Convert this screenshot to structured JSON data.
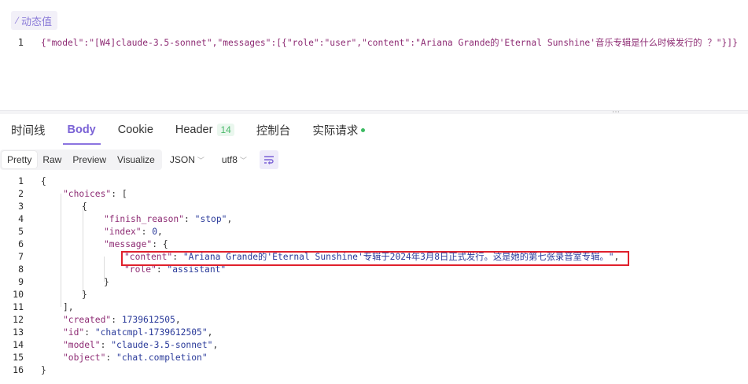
{
  "top": {
    "dynamic_button_label": "动态值",
    "request_line_number": "1",
    "request_body": "{\"model\":\"[W4]claude-3.5-sonnet\",\"messages\":[{\"role\":\"user\",\"content\":\"Ariana Grande的'Eternal Sunshine'音乐专辑是什么时候发行的 ？\"}]}"
  },
  "tabs": [
    {
      "label": "时间线"
    },
    {
      "label": "Body",
      "active": true
    },
    {
      "label": "Cookie"
    },
    {
      "label": "Header",
      "badge": "14"
    },
    {
      "label": "控制台"
    },
    {
      "label": "实际请求",
      "status_dot": true
    }
  ],
  "toolbar": {
    "view_modes": [
      "Pretty",
      "Raw",
      "Preview",
      "Visualize"
    ],
    "active_view": "Pretty",
    "format": "JSON",
    "encoding": "utf8"
  },
  "response_lines": [
    {
      "n": "1",
      "text": "{"
    },
    {
      "n": "2",
      "key": "\"choices\"",
      "rest": ": ["
    },
    {
      "n": "3",
      "text": "{"
    },
    {
      "n": "4",
      "key": "\"finish_reason\"",
      "rest": ": ",
      "val": "\"stop\"",
      "tail": ","
    },
    {
      "n": "5",
      "key": "\"index\"",
      "rest": ": ",
      "val": "0",
      "tail": ","
    },
    {
      "n": "6",
      "key": "\"message\"",
      "rest": ": {"
    },
    {
      "n": "7",
      "key": "\"content\"",
      "rest": ": ",
      "val": "\"Ariana Grande的'Eternal Sunshine'专辑于2024年3月8日正式发行。这是她的第七张录音室专辑。\"",
      "tail": ","
    },
    {
      "n": "8",
      "key": "\"role\"",
      "rest": ": ",
      "val": "\"assistant\""
    },
    {
      "n": "9",
      "text": "}"
    },
    {
      "n": "10",
      "text": "}"
    },
    {
      "n": "11",
      "text": "],"
    },
    {
      "n": "12",
      "key": "\"created\"",
      "rest": ": ",
      "val": "1739612505",
      "tail": ","
    },
    {
      "n": "13",
      "key": "\"id\"",
      "rest": ": ",
      "val": "\"chatcmpl-1739612505\"",
      "tail": ","
    },
    {
      "n": "14",
      "key": "\"model\"",
      "rest": ": ",
      "val": "\"claude-3.5-sonnet\"",
      "tail": ","
    },
    {
      "n": "15",
      "key": "\"object\"",
      "rest": ": ",
      "val": "\"chat.completion\""
    },
    {
      "n": "16",
      "text": "}"
    }
  ],
  "colors": {
    "accent": "#7b63d6",
    "highlight": "#e0202c",
    "badge_green": "#4bb96a"
  }
}
